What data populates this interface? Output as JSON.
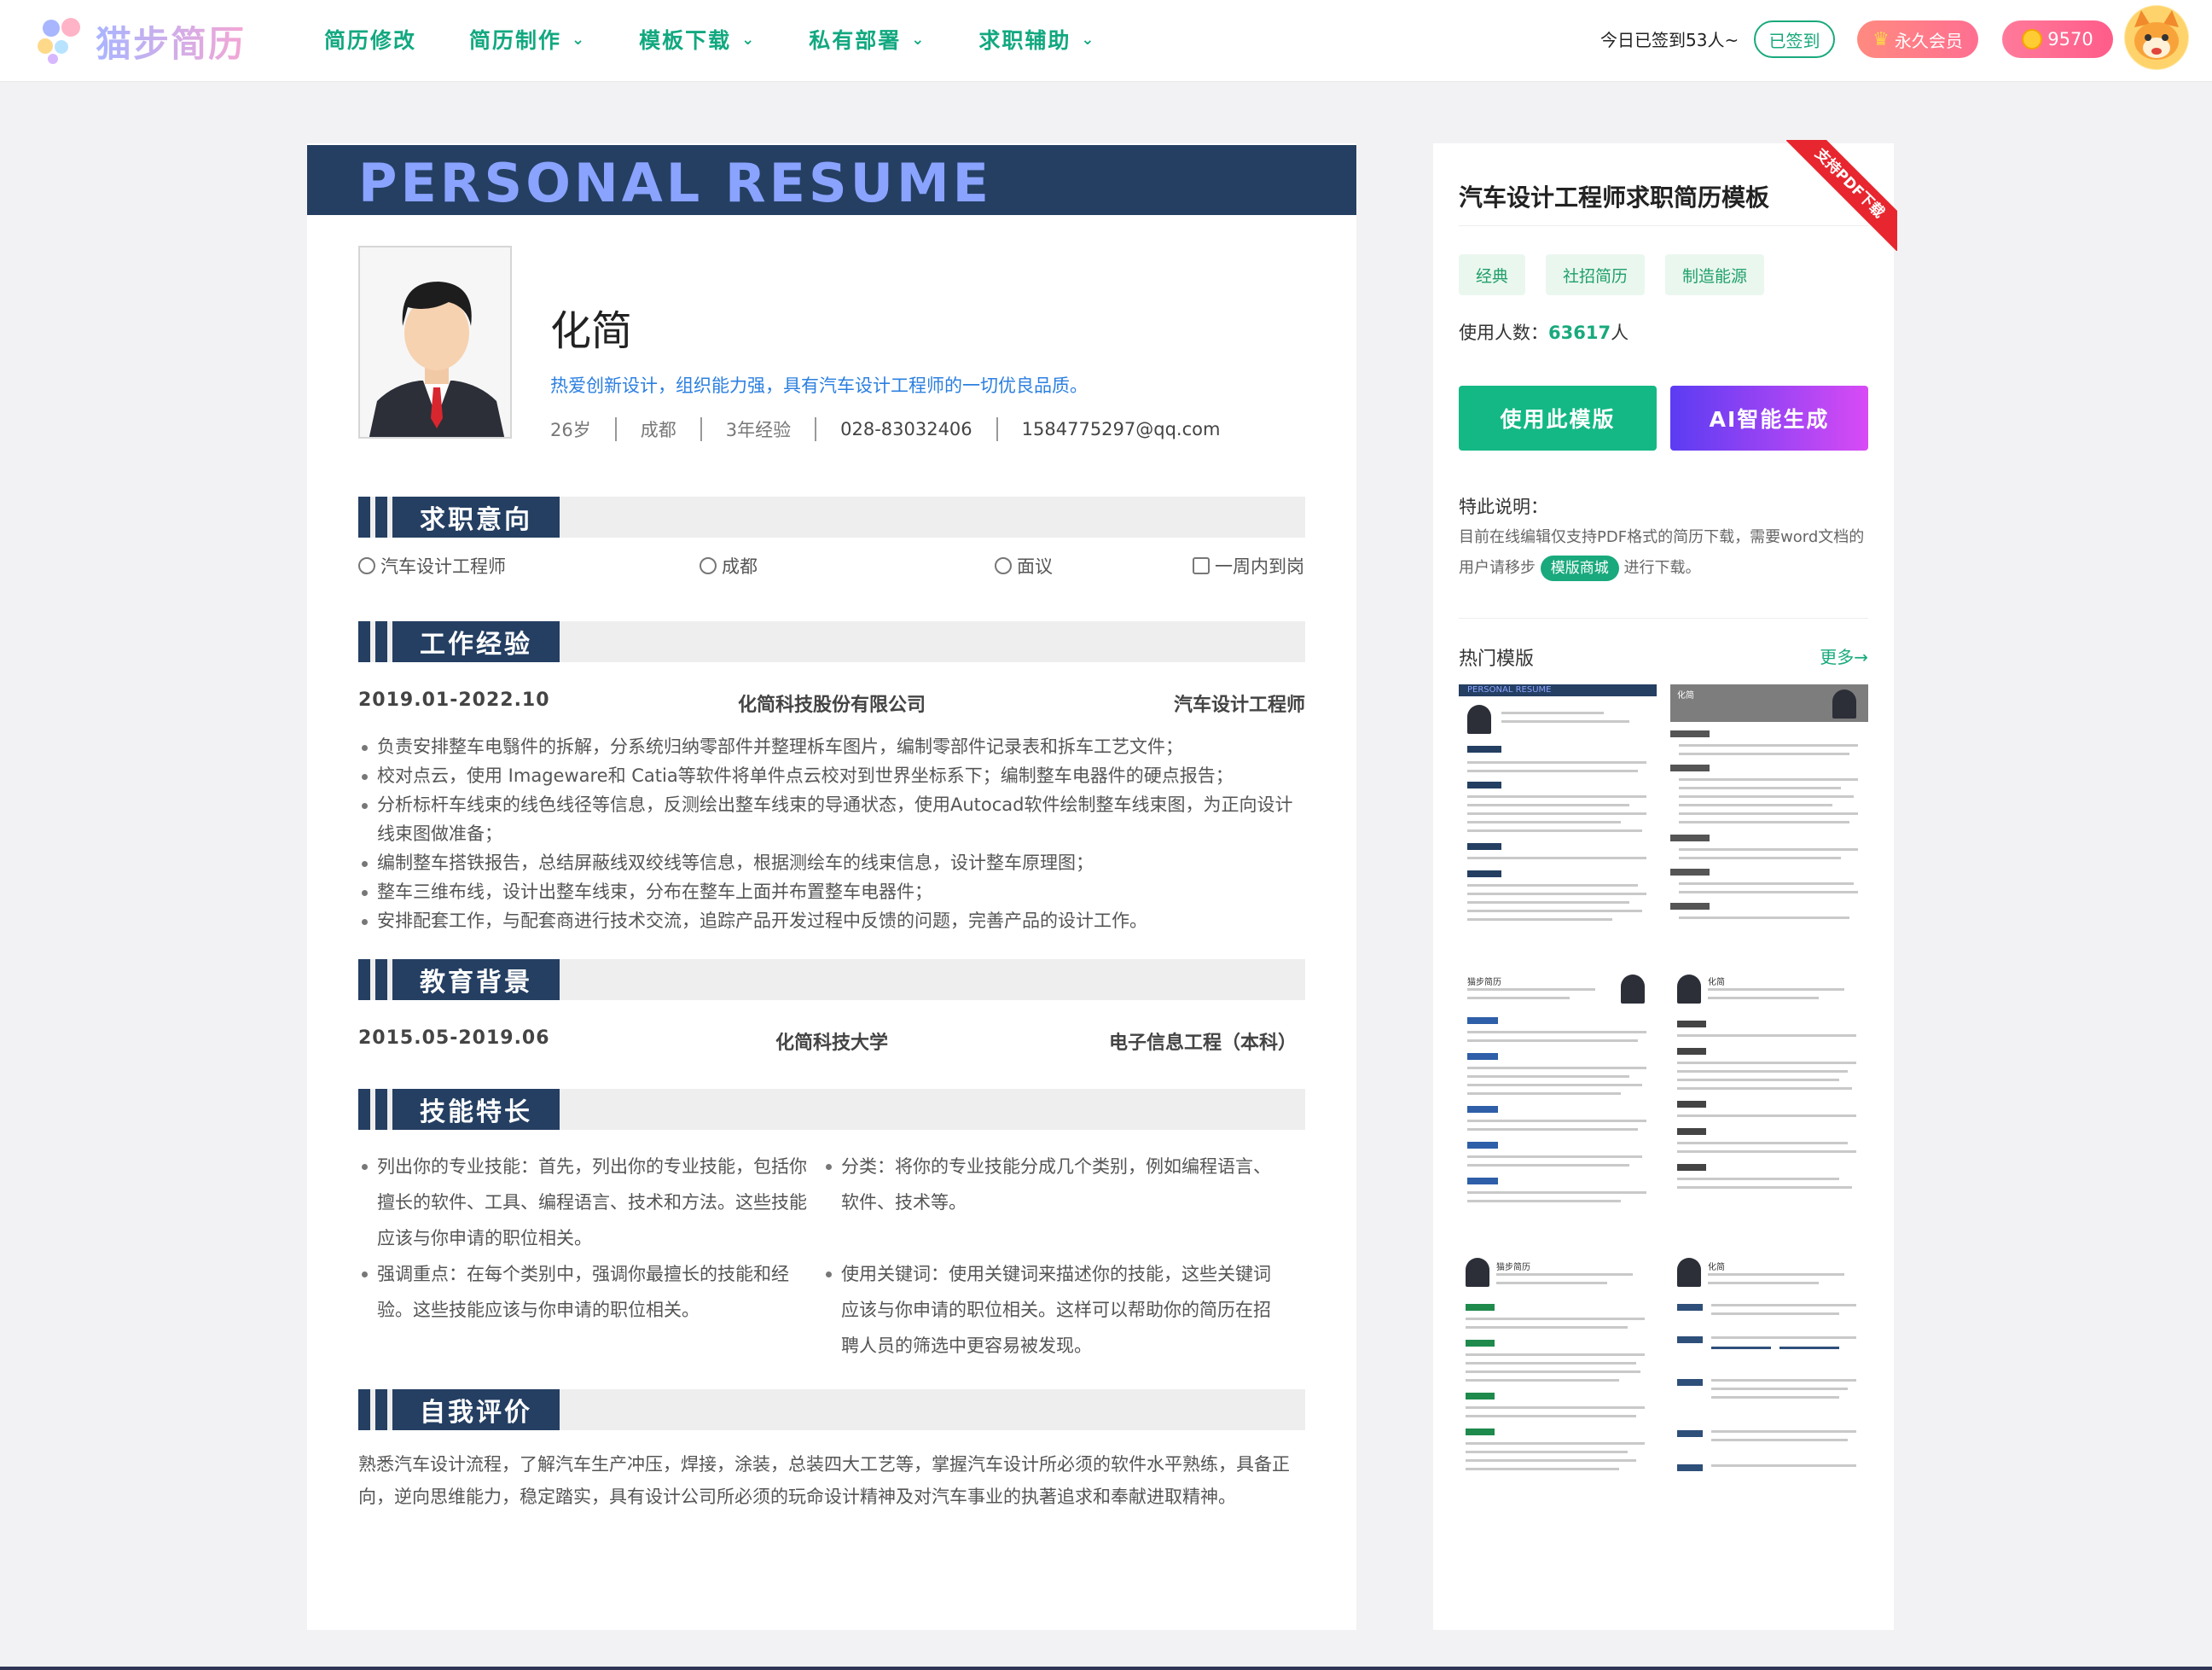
{
  "brand": {
    "name": "猫步简历"
  },
  "nav": {
    "items": [
      {
        "label": "简历修改",
        "has_dropdown": false
      },
      {
        "label": "简历制作",
        "has_dropdown": true
      },
      {
        "label": "模板下载",
        "has_dropdown": true
      },
      {
        "label": "私有部署",
        "has_dropdown": true
      },
      {
        "label": "求职辅助",
        "has_dropdown": true
      }
    ],
    "checkin_text": "今日已签到53人~",
    "signed_label": "已签到",
    "vip_label": "永久会员",
    "coins": "9570"
  },
  "resume": {
    "banner": "PERSONAL RESUME",
    "name": "化简",
    "motto": "热爱创新设计，组织能力强，具有汽车设计工程师的一切优良品质。",
    "info": {
      "age": "26岁",
      "city": "成都",
      "experience": "3年经验",
      "phone": "028-83032406",
      "email": "1584775297@qq.com"
    },
    "sections": {
      "intent": "求职意向",
      "work": "工作经验",
      "edu": "教育背景",
      "skills": "技能特长",
      "self": "自我评价"
    },
    "intent": {
      "position": "汽车设计工程师",
      "city": "成都",
      "salary": "面议",
      "availability": "一周内到岗"
    },
    "work": {
      "period": "2019.01-2022.10",
      "company": "化简科技股份有限公司",
      "title": "汽车设计工程师",
      "bullets": [
        "负责安排整车电翳件的拆解，分系统归纳零部件并整理柝车图片，编制零部件记录表和拆车工艺文件；",
        "校对点云，使用 Imageware和 Catia等软件将单件点云校对到世界坐标系下；编制整车电器件的硬点报告；",
        "分析标杆车线束的线色线径等信息，反测绘出整车线束的导通状态，使用Autocad软件绘制整车线束图，为正向设计线束图做准备；",
        "编制整车搭铁报告，总结屏蔽线双绞线等信息，根据测绘车的线束信息，设计整车原理图；",
        "整车三维布线，设计出整车线束，分布在整车上面并布置整车电器件；",
        "安排配套工作，与配套商进行技术交流，追踪产品开发过程中反馈的问题，完善产品的设计工作。"
      ]
    },
    "edu": {
      "period": "2015.05-2019.06",
      "school": "化简科技大学",
      "major": "电子信息工程（本科）"
    },
    "skills": [
      "列出你的专业技能：首先，列出你的专业技能，包括你擅长的软件、工具、编程语言、技术和方法。这些技能应该与你申请的职位相关。",
      "分类：将你的专业技能分成几个类别，例如编程语言、软件、技术等。",
      "强调重点：在每个类别中，强调你最擅长的技能和经验。这些技能应该与你申请的职位相关。",
      "使用关键词：使用关键词来描述你的技能，这些关键词应该与你申请的职位相关。这样可以帮助你的简历在招聘人员的筛选中更容易被发现。"
    ],
    "self_eval": "熟悉汽车设计流程，了解汽车生产冲压，焊接，涂装，总装四大工艺等，掌握汽车设计所必须的软件水平熟练，具备正向，逆向思维能力，稳定踏实，具有设计公司所必须的玩命设计精神及对汽车事业的执著追求和奉献进取精神。"
  },
  "panel": {
    "ribbon": "支持PDF下载",
    "title": "汽车设计工程师求职简历模板",
    "tags": [
      "经典",
      "社招简历",
      "制造能源"
    ],
    "users_label": "使用人数：",
    "users_count": "63617",
    "users_unit": "人",
    "use_button": "使用此模版",
    "ai_button": "AI智能生成",
    "note_title": "特此说明：",
    "note_text_1": "目前在线编辑仅支持PDF格式的简历下载，需要word文档的用户请移步",
    "note_pill": "模版商城",
    "note_text_2": "进行下载。",
    "hot_title": "热门模版",
    "hot_more": "更多→",
    "thumb_labels": [
      "PERSONAL RESUME",
      "化简",
      "猫步简历",
      "化简",
      "猫步简历",
      "化简"
    ]
  },
  "colors": {
    "brand_green": "#19a97c",
    "navy": "#243f62",
    "banner_text": "#8aa3ff",
    "ai_start": "#5b3cf2",
    "ai_end": "#d84bf5"
  }
}
